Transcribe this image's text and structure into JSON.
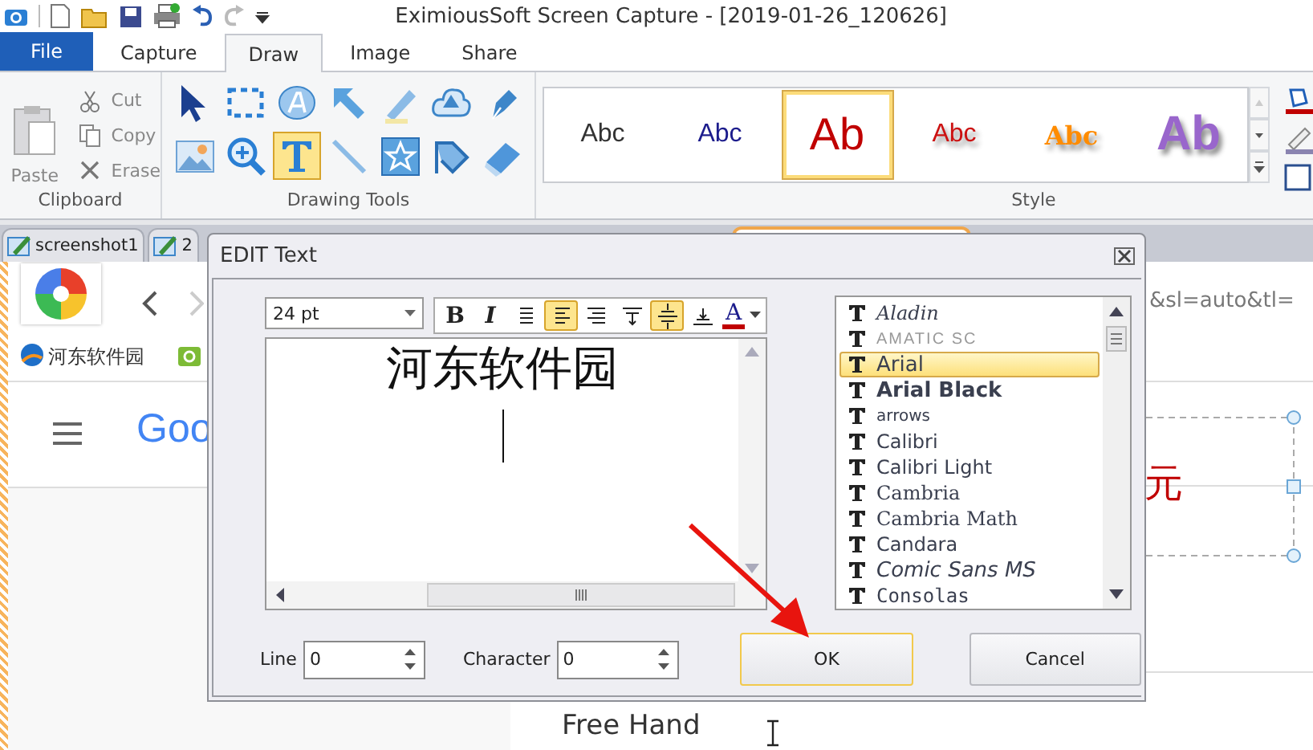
{
  "window": {
    "title": "EximiousSoft Screen Capture - [2019-01-26_120626]"
  },
  "ribbon_tabs": [
    {
      "label": "File",
      "kind": "file",
      "selected": false
    },
    {
      "label": "Capture",
      "kind": "tab",
      "selected": false
    },
    {
      "label": "Draw",
      "kind": "tab",
      "selected": true
    },
    {
      "label": "Image",
      "kind": "tab",
      "selected": false
    },
    {
      "label": "Share",
      "kind": "tab",
      "selected": false
    }
  ],
  "clipboard": {
    "title": "Clipboard",
    "paste": {
      "label": "Paste",
      "disabled": true
    },
    "items": [
      {
        "label": "Cut",
        "disabled": true
      },
      {
        "label": "Copy",
        "disabled": true
      },
      {
        "label": "Erase",
        "disabled": true
      }
    ]
  },
  "drawing_tools": {
    "title": "Drawing Tools",
    "tools": [
      {
        "selected": false
      },
      {
        "selected": false
      },
      {
        "selected": false
      },
      {
        "selected": false
      },
      {
        "selected": false
      },
      {
        "selected": false
      },
      {
        "selected": false
      },
      {
        "selected": false
      },
      {
        "selected": false
      },
      {
        "selected": true
      },
      {
        "selected": false
      },
      {
        "selected": false
      },
      {
        "selected": false
      },
      {
        "selected": false
      }
    ]
  },
  "style_gallery": {
    "title": "Style",
    "items": [
      {
        "sample": "Abc",
        "color": "#333333",
        "selected": false
      },
      {
        "sample": "Abc",
        "color": "#1c1c8c",
        "selected": false
      },
      {
        "sample": "Ab",
        "color": "#c00000",
        "selected": true
      },
      {
        "sample": "Abc",
        "color": "#cc1111",
        "selected": false
      },
      {
        "sample": "Abc",
        "color": "#ff8c00",
        "selected": false
      },
      {
        "sample": "Ab",
        "color": "#9966cc",
        "selected": false
      }
    ]
  },
  "document_tabs": [
    {
      "label": "screenshot1",
      "selected": false
    },
    {
      "label": "2",
      "selected": false
    },
    {
      "selected": true
    }
  ],
  "canvas": {
    "bookmark": "河东软件园",
    "logo_text": "Goo",
    "url_fragment": "&sl=auto&tl=",
    "red_character": "元",
    "free_hand": "Free Hand"
  },
  "dialog": {
    "title": "EDIT Text",
    "font_size": "24 pt",
    "format_buttons": [
      {
        "kind": "bold",
        "label": "B",
        "selected": false
      },
      {
        "kind": "italic",
        "label": "I",
        "selected": false
      },
      {
        "kind": "justify",
        "selected": false
      },
      {
        "kind": "align-left",
        "selected": true
      },
      {
        "kind": "align-right",
        "selected": false
      },
      {
        "kind": "valign-top",
        "selected": false
      },
      {
        "kind": "valign-middle",
        "selected": true
      },
      {
        "kind": "valign-bottom",
        "selected": false
      },
      {
        "kind": "color",
        "label": "A",
        "color": "#c00000",
        "selected": false
      }
    ],
    "text": "河东软件园",
    "fonts": [
      {
        "name": "Aladin",
        "selected": false
      },
      {
        "name": "AMATIC SC",
        "selected": false
      },
      {
        "name": "Arial",
        "selected": true
      },
      {
        "name": "Arial Black",
        "selected": false
      },
      {
        "name": "arrows",
        "selected": false
      },
      {
        "name": "Calibri",
        "selected": false
      },
      {
        "name": "Calibri Light",
        "selected": false
      },
      {
        "name": "Cambria",
        "selected": false
      },
      {
        "name": "Cambria Math",
        "selected": false
      },
      {
        "name": "Candara",
        "selected": false
      },
      {
        "name": "Comic Sans MS",
        "selected": false
      },
      {
        "name": "Consolas",
        "selected": false
      }
    ],
    "line": {
      "label": "Line",
      "value": "0"
    },
    "character": {
      "label": "Character",
      "value": "0"
    },
    "buttons": [
      {
        "label": "OK",
        "kind": "default"
      },
      {
        "label": "Cancel",
        "kind": "normal"
      }
    ]
  }
}
